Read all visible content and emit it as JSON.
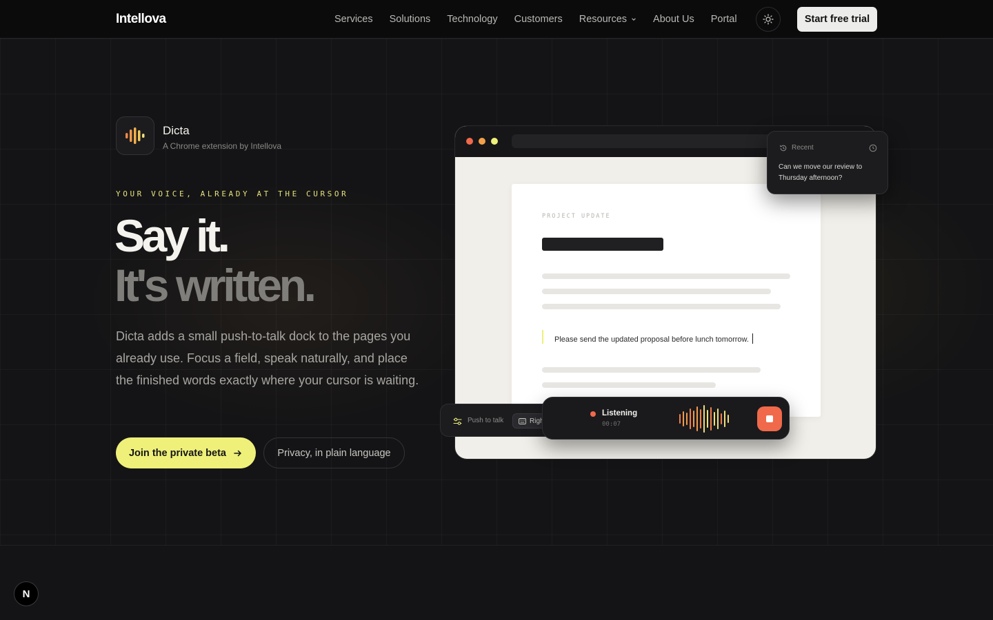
{
  "nav": {
    "logo": "Intellova",
    "links": [
      {
        "label": "Services"
      },
      {
        "label": "Solutions"
      },
      {
        "label": "Technology"
      },
      {
        "label": "Customers"
      },
      {
        "label": "Resources"
      },
      {
        "label": "About Us"
      },
      {
        "label": "Portal"
      }
    ],
    "theme_icon": "sun-icon",
    "cta_label": "Start free trial"
  },
  "hero": {
    "app_name": "Dicta",
    "app_subtitle": "A Chrome extension by Intellova",
    "eyebrow": "YOUR VOICE, ALREADY AT THE CURSOR",
    "headline_line1": "Say it.",
    "headline_line2": "It's written.",
    "description": "Dicta adds a small push-to-talk dock to the pages you already use. Focus a field, speak naturally, and place the finished words exactly where your cursor is waiting.",
    "primary_button": "Join the private beta",
    "secondary_button": "Privacy, in plain language"
  },
  "mockup": {
    "doc_eyebrow": "PROJECT UPDATE",
    "dictated_text": "Please send the updated proposal before lunch tomorrow.",
    "recent": {
      "label": "Recent",
      "text": "Can we move our review to Thursday afternoon?"
    },
    "dock": {
      "push_to_talk_label": "Push to talk",
      "key_label": "Right Option",
      "status": "Listening",
      "elapsed": "00:07"
    }
  },
  "colors": {
    "accent_yellow": "#eef07a",
    "record_orange": "#f0694a",
    "background": "#141416"
  },
  "corner_badge": "N"
}
